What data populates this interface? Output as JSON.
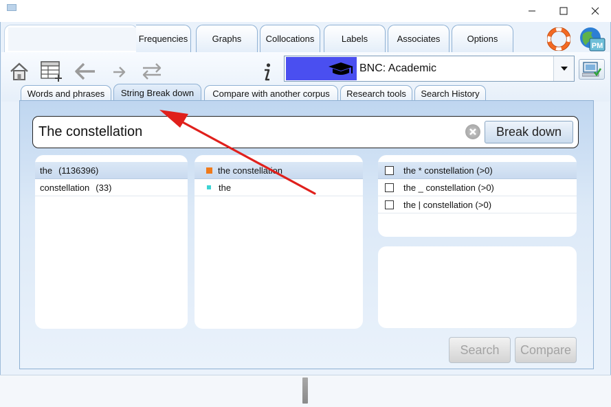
{
  "main_tabs": [
    {
      "label": ""
    },
    {
      "label": "Frequencies"
    },
    {
      "label": "Graphs"
    },
    {
      "label": "Collocations"
    },
    {
      "label": "Labels"
    },
    {
      "label": "Associates"
    },
    {
      "label": "Options"
    }
  ],
  "badge": {
    "text": "PM"
  },
  "corpus": {
    "selected": "BNC: Academic"
  },
  "sub_tabs": [
    {
      "label": "Words and phrases"
    },
    {
      "label": "String Break down"
    },
    {
      "label": "Compare with another corpus"
    },
    {
      "label": "Research tools"
    },
    {
      "label": "Search History"
    }
  ],
  "search": {
    "value": "The constellation",
    "button": "Break down"
  },
  "words": [
    {
      "word": "the",
      "count": "(1136396)"
    },
    {
      "word": "constellation",
      "count": "(33)"
    }
  ],
  "phrases": [
    {
      "text": "the constellation",
      "color": "#f07a1a"
    },
    {
      "text": "the",
      "color": "#3dd4d4"
    }
  ],
  "patterns": [
    {
      "text": "the * constellation (>0)"
    },
    {
      "text": "the _ constellation (>0)"
    },
    {
      "text": "the | constellation (>0)"
    }
  ],
  "actions": {
    "search": "Search",
    "compare": "Compare"
  },
  "colors": {
    "accent": "#8eb0d3",
    "annotation": "#e0201c",
    "corpus_logo": "#4a4ff0"
  }
}
